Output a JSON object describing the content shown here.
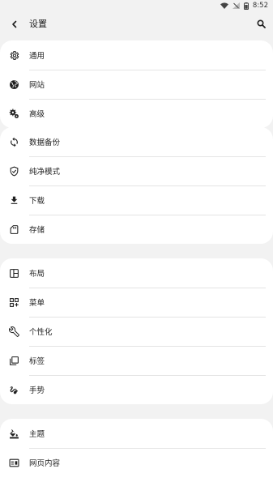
{
  "status_bar": {
    "time": "8:52"
  },
  "header": {
    "title": "设置"
  },
  "groups": [
    {
      "items": [
        {
          "icon": "gear-icon",
          "label": "通用"
        },
        {
          "icon": "globe-icon",
          "label": "网站"
        },
        {
          "icon": "gears-icon",
          "label": "高级"
        }
      ]
    },
    {
      "items": [
        {
          "icon": "sync-icon",
          "label": "数据备份"
        },
        {
          "icon": "shield-check-icon",
          "label": "纯净模式"
        },
        {
          "icon": "download-icon",
          "label": "下载"
        },
        {
          "icon": "sd-card-icon",
          "label": "存储"
        }
      ]
    },
    {
      "items": [
        {
          "icon": "layout-icon",
          "label": "布局"
        },
        {
          "icon": "qr-grid-icon",
          "label": "菜单"
        },
        {
          "icon": "wrench-icon",
          "label": "个性化"
        },
        {
          "icon": "tabs-icon",
          "label": "标签"
        },
        {
          "icon": "gesture-icon",
          "label": "手势"
        }
      ]
    },
    {
      "items": [
        {
          "icon": "paint-bucket-icon",
          "label": "主题"
        },
        {
          "icon": "web-content-icon",
          "label": "网页内容"
        }
      ]
    }
  ]
}
